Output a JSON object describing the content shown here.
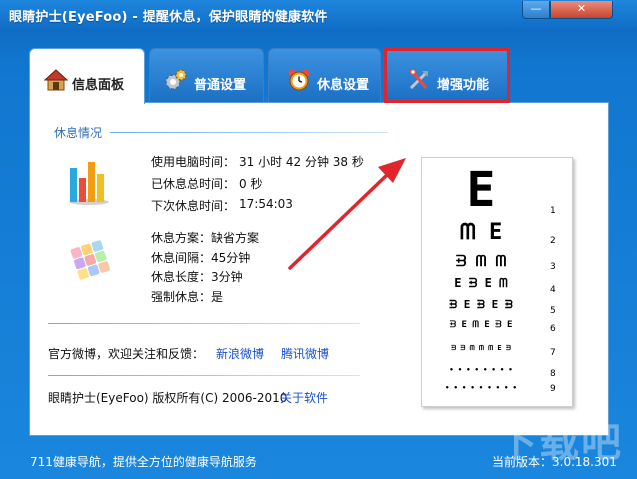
{
  "window": {
    "title": "眼睛护士(EyeFoo) - 提醒休息，保护眼睛的健康软件",
    "minimize_glyph": "—",
    "close_glyph": "✕"
  },
  "tabs": [
    {
      "label": "信息面板",
      "icon": "house-icon",
      "active": true
    },
    {
      "label": "普通设置",
      "icon": "gears-icon",
      "active": false
    },
    {
      "label": "休息设置",
      "icon": "alarm-clock-icon",
      "active": false
    },
    {
      "label": "增强功能",
      "icon": "tools-icon",
      "active": false,
      "highlighted": true
    }
  ],
  "rest_section": {
    "title": "休息情况",
    "stats": {
      "usage_label": "使用电脑时间：",
      "usage_value": "31 小时 42 分钟 38 秒",
      "rested_label": "已休息总时间：",
      "rested_value": "0 秒",
      "next_label": "下次休息时间：",
      "next_value": "17:54:03"
    },
    "plan": {
      "scheme_label": "休息方案：",
      "scheme_value": "缺省方案",
      "interval_label": "休息间隔：",
      "interval_value": "45分钟",
      "length_label": "休息长度：",
      "length_value": "3分钟",
      "forced_label": "强制休息：",
      "forced_value": "是"
    }
  },
  "weibo": {
    "text": "官方微博，欢迎关注和反馈：",
    "sina": "新浪微博",
    "tencent": "腾讯微博"
  },
  "copyright": {
    "text": "眼睛护士(EyeFoo) 版权所有(C) 2006-2010",
    "about": "关于软件"
  },
  "eye_chart": {
    "rows": [
      "E",
      "ᗰ E",
      "ᗲ ᗰ ᗰ",
      "E ᗲ E ᗰ",
      "ᗲ E ᗲ E ᗲ",
      "ᗲ E ᗰ E ᗲ E",
      "ᗲ ᗲ ᗰ ᗰ ᗰ E ᗲ",
      "• • • • • • • •",
      "• • • • • • • • •"
    ],
    "numbers": [
      "1",
      "2",
      "3",
      "4",
      "5",
      "6",
      "7",
      "8",
      "9"
    ]
  },
  "footer": {
    "nav_text": "711健康导航，提供全方位的健康导航服务",
    "version": "当前版本：3.0.18.301"
  },
  "watermark": "下载吧",
  "colors": {
    "window_blue": "#1176cf",
    "highlight_red": "#e0262c",
    "arrow_red": "#e0262c",
    "link_blue": "#1a4fd0",
    "section_title": "#2f6fb6"
  }
}
